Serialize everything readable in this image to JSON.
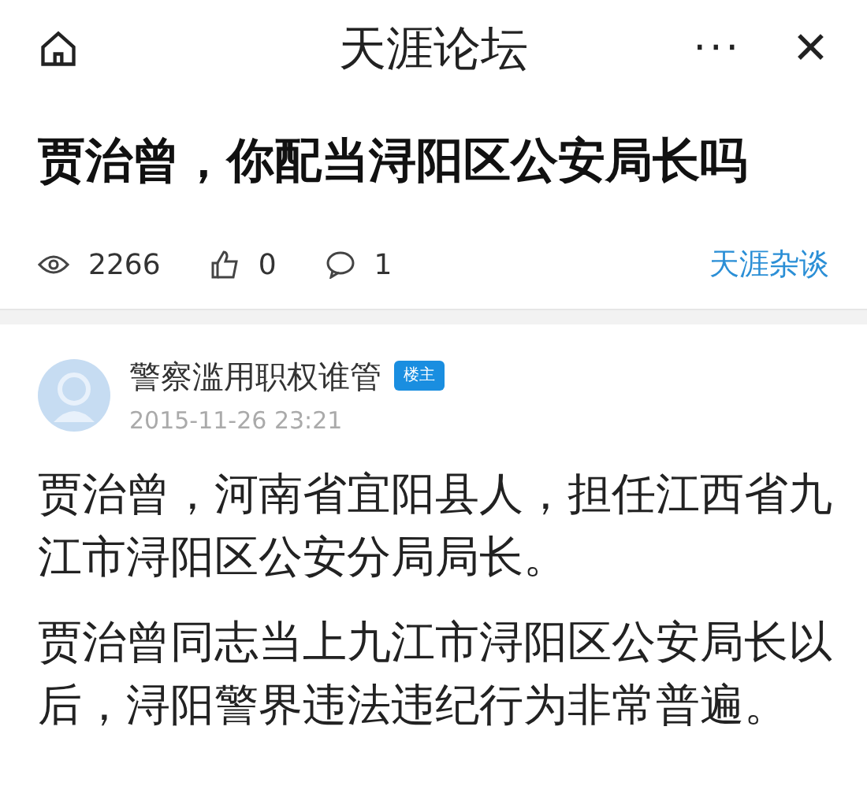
{
  "header": {
    "title": "天涯论坛",
    "more": "···",
    "close": "✕"
  },
  "post_title": "贾治曾，你配当浔阳区公安局长吗",
  "stats": {
    "views": "2266",
    "likes": "0",
    "comments": "1",
    "board": "天涯杂谈"
  },
  "author": {
    "name": "警察滥用职权谁管",
    "badge": "楼主",
    "time": "2015-11-26 23:21"
  },
  "paragraphs": [
    "贾治曾，河南省宜阳县人，担任江西省九江市浔阳区公安分局局长。",
    "贾治曾同志当上九江市浔阳区公安局长以后，浔阳警界违法违纪行为非常普遍。"
  ]
}
